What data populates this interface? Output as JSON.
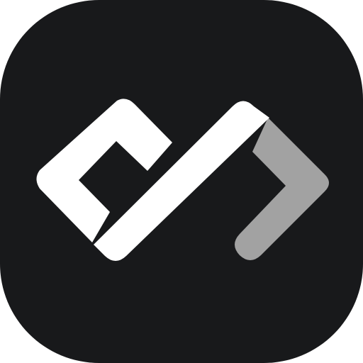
{
  "app_icon": {
    "icon": "code-brackets-logo-icon",
    "colors": {
      "background": "#ffffff",
      "tile": "#18191b",
      "primary_mark": "#ffffff",
      "secondary_mark": "#a2a2a2"
    }
  }
}
